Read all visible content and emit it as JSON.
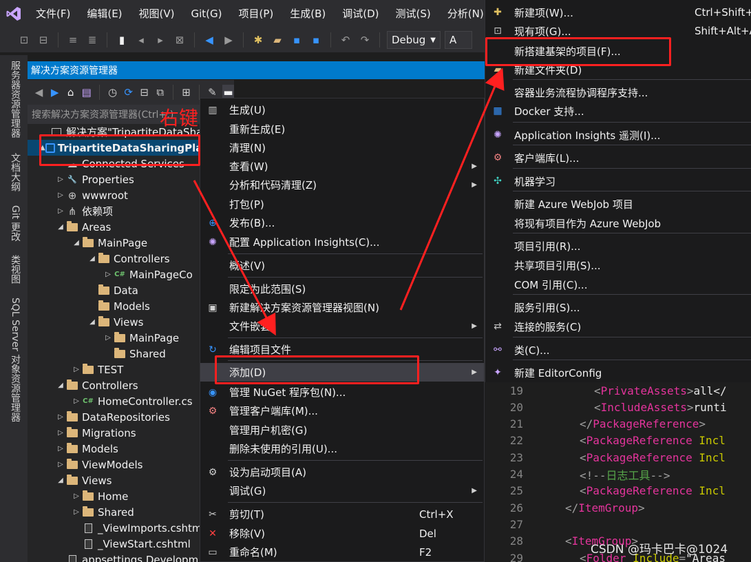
{
  "menubar": {
    "items": [
      "文件(F)",
      "编辑(E)",
      "视图(V)",
      "Git(G)",
      "项目(P)",
      "生成(B)",
      "调试(D)",
      "测试(S)",
      "分析(N)"
    ]
  },
  "toolbar": {
    "config": "Debug",
    "platform": "A"
  },
  "vertical_tabs": [
    "服务器资源管理器",
    "文档大纲",
    "Git 更改",
    "类视图",
    "SQL Server 对象资源管理器"
  ],
  "solution_explorer": {
    "title": "解决方案资源管理器",
    "search_placeholder": "搜索解决方案资源管理器(Ctrl+;)",
    "tree": [
      {
        "label": "解决方案\"TripartiteDataShari",
        "depth": 0,
        "kind": "solution",
        "twisty": ""
      },
      {
        "label": "TripartiteDataSharingPla",
        "depth": 0,
        "kind": "project",
        "twisty": "▲",
        "selected": true
      },
      {
        "label": "Connected Services",
        "depth": 1,
        "kind": "services",
        "twisty": ""
      },
      {
        "label": "Properties",
        "depth": 1,
        "kind": "props",
        "twisty": "▷"
      },
      {
        "label": "wwwroot",
        "depth": 1,
        "kind": "globe",
        "twisty": "▷"
      },
      {
        "label": "依赖项",
        "depth": 1,
        "kind": "deps",
        "twisty": "▷"
      },
      {
        "label": "Areas",
        "depth": 1,
        "kind": "folder",
        "twisty": "◢"
      },
      {
        "label": "MainPage",
        "depth": 2,
        "kind": "folder",
        "twisty": "◢"
      },
      {
        "label": "Controllers",
        "depth": 3,
        "kind": "folder",
        "twisty": "◢"
      },
      {
        "label": "MainPageCo",
        "depth": 4,
        "kind": "cs",
        "twisty": "▷"
      },
      {
        "label": "Data",
        "depth": 3,
        "kind": "folder",
        "twisty": ""
      },
      {
        "label": "Models",
        "depth": 3,
        "kind": "folder",
        "twisty": ""
      },
      {
        "label": "Views",
        "depth": 3,
        "kind": "folder",
        "twisty": "◢"
      },
      {
        "label": "MainPage",
        "depth": 4,
        "kind": "folder",
        "twisty": "▷"
      },
      {
        "label": "Shared",
        "depth": 4,
        "kind": "folder",
        "twisty": ""
      },
      {
        "label": "TEST",
        "depth": 2,
        "kind": "folder",
        "twisty": "▷"
      },
      {
        "label": "Controllers",
        "depth": 1,
        "kind": "folder",
        "twisty": "◢"
      },
      {
        "label": "HomeController.cs",
        "depth": 2,
        "kind": "cs",
        "twisty": "▷"
      },
      {
        "label": "DataRepositories",
        "depth": 1,
        "kind": "folder",
        "twisty": "▷"
      },
      {
        "label": "Migrations",
        "depth": 1,
        "kind": "folder",
        "twisty": "▷"
      },
      {
        "label": "Models",
        "depth": 1,
        "kind": "folder",
        "twisty": "▷"
      },
      {
        "label": "ViewModels",
        "depth": 1,
        "kind": "folder",
        "twisty": "▷"
      },
      {
        "label": "Views",
        "depth": 1,
        "kind": "folder",
        "twisty": "◢"
      },
      {
        "label": "Home",
        "depth": 2,
        "kind": "folder",
        "twisty": "▷"
      },
      {
        "label": "Shared",
        "depth": 2,
        "kind": "folder",
        "twisty": "▷"
      },
      {
        "label": "_ViewImports.cshtml",
        "depth": 2,
        "kind": "file",
        "twisty": ""
      },
      {
        "label": "_ViewStart.cshtml",
        "depth": 2,
        "kind": "file",
        "twisty": ""
      },
      {
        "label": "appsettings.Developm",
        "depth": 1,
        "kind": "file",
        "twisty": ""
      }
    ]
  },
  "context_menu": {
    "items": [
      {
        "label": "生成(U)",
        "icon": "build-icon"
      },
      {
        "label": "重新生成(E)",
        "icon": ""
      },
      {
        "label": "清理(N)",
        "icon": ""
      },
      {
        "label": "查看(W)",
        "icon": "",
        "submenu": true
      },
      {
        "label": "分析和代码清理(Z)",
        "icon": "",
        "submenu": true
      },
      {
        "label": "打包(P)",
        "icon": ""
      },
      {
        "label": "发布(B)...",
        "icon": "globe-icon"
      },
      {
        "label": "配置 Application Insights(C)...",
        "icon": "bulb-icon"
      },
      {
        "label": "概述(V)",
        "icon": "",
        "sep_before": true
      },
      {
        "label": "限定为此范围(S)",
        "icon": "",
        "sep_before": true
      },
      {
        "label": "新建解决方案资源管理器视图(N)",
        "icon": "new-view-icon"
      },
      {
        "label": "文件嵌套",
        "icon": "",
        "submenu": true
      },
      {
        "label": "编辑项目文件",
        "icon": "refresh-icon",
        "sep_before": true
      },
      {
        "label": "添加(D)",
        "icon": "",
        "submenu": true,
        "highlighted": true,
        "sep_before": true
      },
      {
        "label": "管理 NuGet 程序包(N)...",
        "icon": "nuget-icon"
      },
      {
        "label": "管理客户端库(M)...",
        "icon": "library-icon"
      },
      {
        "label": "管理用户机密(G)",
        "icon": ""
      },
      {
        "label": "删除未使用的引用(U)...",
        "icon": ""
      },
      {
        "label": "设为启动项目(A)",
        "icon": "gear-icon",
        "sep_before": true
      },
      {
        "label": "调试(G)",
        "icon": "",
        "submenu": true
      },
      {
        "label": "剪切(T)",
        "icon": "scissors-icon",
        "shortcut": "Ctrl+X",
        "sep_before": true
      },
      {
        "label": "移除(V)",
        "icon": "x-icon",
        "shortcut": "Del"
      },
      {
        "label": "重命名(M)",
        "icon": "rename-icon",
        "shortcut": "F2"
      }
    ]
  },
  "add_submenu": {
    "items": [
      {
        "label": "新建项(W)...",
        "icon": "new-item-icon",
        "shortcut": "Ctrl+Shift+A"
      },
      {
        "label": "现有项(G)...",
        "icon": "existing-item-icon",
        "shortcut": "Shift+Alt+A"
      },
      {
        "label": "新搭建基架的项目(F)...",
        "icon": ""
      },
      {
        "label": "新建文件夹(D)",
        "icon": "new-folder-icon"
      },
      {
        "label": "容器业务流程协调程序支持...",
        "icon": "",
        "sep_before": true
      },
      {
        "label": "Docker 支持...",
        "icon": "docker-icon"
      },
      {
        "label": "Application Insights 遥测(I)...",
        "icon": "bulb-icon",
        "sep_before": true
      },
      {
        "label": "客户端库(L)...",
        "icon": "library-icon",
        "sep_before": true
      },
      {
        "label": "机器学习",
        "icon": "ml-icon",
        "sep_before": true
      },
      {
        "label": "新建 Azure WebJob 项目",
        "icon": "",
        "sep_before": true
      },
      {
        "label": "将现有项目作为 Azure WebJob",
        "icon": ""
      },
      {
        "label": "项目引用(R)...",
        "icon": "",
        "sep_before": true
      },
      {
        "label": "共享项目引用(S)...",
        "icon": ""
      },
      {
        "label": "COM 引用(C)...",
        "icon": ""
      },
      {
        "label": "服务引用(S)...",
        "icon": "",
        "sep_before": true
      },
      {
        "label": "连接的服务(C)",
        "icon": "connected-icon"
      },
      {
        "label": "类(C)...",
        "icon": "class-icon",
        "sep_before": true
      },
      {
        "label": "新建 EditorConfig",
        "icon": "editorconfig-icon",
        "sep_before": true
      }
    ]
  },
  "editor": {
    "lines": [
      {
        "n": "19",
        "indent": 3,
        "parts": [
          [
            "punc",
            "<"
          ],
          [
            "tag",
            "PrivateAssets"
          ],
          [
            "punc",
            ">"
          ],
          [
            "text",
            "all</"
          ]
        ]
      },
      {
        "n": "20",
        "indent": 3,
        "parts": [
          [
            "punc",
            "<"
          ],
          [
            "tag",
            "IncludeAssets"
          ],
          [
            "punc",
            ">"
          ],
          [
            "text",
            "runti"
          ]
        ]
      },
      {
        "n": "21",
        "indent": 2,
        "parts": [
          [
            "punc",
            "</"
          ],
          [
            "tag",
            "PackageReference"
          ],
          [
            "punc",
            ">"
          ]
        ]
      },
      {
        "n": "22",
        "indent": 2,
        "parts": [
          [
            "punc",
            "<"
          ],
          [
            "tag",
            "PackageReference"
          ],
          [
            "text",
            " "
          ],
          [
            "attr",
            "Incl"
          ]
        ]
      },
      {
        "n": "23",
        "indent": 2,
        "parts": [
          [
            "punc",
            "<"
          ],
          [
            "tag",
            "PackageReference"
          ],
          [
            "text",
            " "
          ],
          [
            "attr",
            "Incl"
          ]
        ]
      },
      {
        "n": "24",
        "indent": 2,
        "parts": [
          [
            "punc",
            "<!--"
          ],
          [
            "comment",
            "日志工具"
          ],
          [
            "punc",
            "-->"
          ]
        ]
      },
      {
        "n": "25",
        "indent": 2,
        "parts": [
          [
            "punc",
            "<"
          ],
          [
            "tag",
            "PackageReference"
          ],
          [
            "text",
            " "
          ],
          [
            "attr",
            "Incl"
          ]
        ]
      },
      {
        "n": "26",
        "indent": 1,
        "parts": [
          [
            "punc",
            "</"
          ],
          [
            "tag",
            "ItemGroup"
          ],
          [
            "punc",
            ">"
          ]
        ]
      },
      {
        "n": "27",
        "indent": 0,
        "parts": []
      },
      {
        "n": "28",
        "indent": 1,
        "parts": [
          [
            "punc",
            "<"
          ],
          [
            "tag",
            "ItemGroup"
          ],
          [
            "punc",
            ">"
          ]
        ]
      },
      {
        "n": "29",
        "indent": 2,
        "parts": [
          [
            "punc",
            "<"
          ],
          [
            "tag",
            "Folder"
          ],
          [
            "text",
            " "
          ],
          [
            "attr",
            "Include"
          ],
          [
            "punc",
            "="
          ],
          [
            "text",
            "\"Areas"
          ]
        ]
      }
    ]
  },
  "annotation": {
    "label": "右键"
  },
  "watermark": "CSDN @玛卡巴卡@1024",
  "colors": {
    "accent": "#007acc",
    "annotation": "#ff2020",
    "menu_bg": "#1b1b1c",
    "highlight": "#3f3f46"
  }
}
